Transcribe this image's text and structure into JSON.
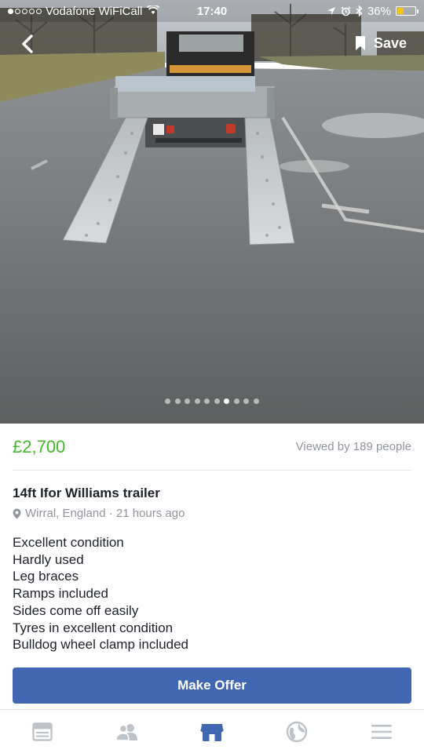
{
  "status_bar": {
    "carrier": "Vodafone WiFiCall",
    "time": "17:40",
    "battery": "36%",
    "battery_level": 0.36
  },
  "header": {
    "save_label": "Save"
  },
  "gallery": {
    "photo_count": 10,
    "active_index": 6
  },
  "listing": {
    "price": "£2,700",
    "views": "Viewed by 189 people",
    "title": "14ft Ifor Williams trailer",
    "location": "Wirral, England · 21 hours ago",
    "description": [
      "Excellent condition",
      "Hardly used",
      "Leg braces",
      "Ramps included",
      "Sides come off easily",
      "Tyres in excellent condition",
      "Bulldog wheel clamp included"
    ]
  },
  "actions": {
    "make_offer_label": "Make Offer"
  },
  "tabs": [
    {
      "icon": "news-feed-icon",
      "active": false
    },
    {
      "icon": "friends-icon",
      "active": false
    },
    {
      "icon": "marketplace-icon",
      "active": true
    },
    {
      "icon": "globe-notifications-icon",
      "active": false
    },
    {
      "icon": "menu-icon",
      "active": false
    }
  ],
  "colors": {
    "price": "#42b72a",
    "button": "#4267b2",
    "tab_active": "#4267b2",
    "tab_inactive": "#bec3c9"
  }
}
